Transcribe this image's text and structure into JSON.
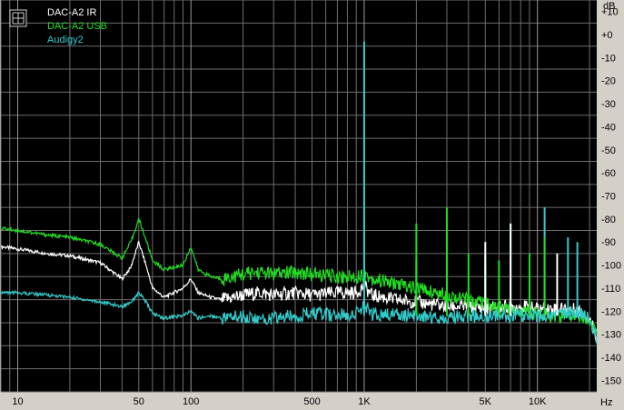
{
  "chart_data": {
    "type": "line",
    "x_scale": "log",
    "xlim": [
      8,
      22000
    ],
    "ylim": [
      -155,
      15
    ],
    "grid": true,
    "background": "#000000",
    "legend_placement": "top-left",
    "xlabel": "Hz",
    "ylabel": "dB",
    "x_ticks": [
      {
        "value": 10,
        "label": "10"
      },
      {
        "value": 50,
        "label": "50"
      },
      {
        "value": 100,
        "label": "100"
      },
      {
        "value": 500,
        "label": "500"
      },
      {
        "value": 1000,
        "label": "1K"
      },
      {
        "value": 5000,
        "label": "5K"
      },
      {
        "value": 10000,
        "label": "10K"
      }
    ],
    "y_ticks": [
      {
        "value": 10,
        "label": "+10"
      },
      {
        "value": 0,
        "label": "+0"
      },
      {
        "value": -10,
        "label": "-10"
      },
      {
        "value": -20,
        "label": "-20"
      },
      {
        "value": -30,
        "label": "-30"
      },
      {
        "value": -40,
        "label": "-40"
      },
      {
        "value": -50,
        "label": "-50"
      },
      {
        "value": -60,
        "label": "-60"
      },
      {
        "value": -70,
        "label": "-70"
      },
      {
        "value": -80,
        "label": "-80"
      },
      {
        "value": -90,
        "label": "-90"
      },
      {
        "value": -100,
        "label": "-100"
      },
      {
        "value": -110,
        "label": "-110"
      },
      {
        "value": -120,
        "label": "-120"
      },
      {
        "value": -130,
        "label": "-130"
      },
      {
        "value": -140,
        "label": "-140"
      },
      {
        "value": -150,
        "label": "-150"
      }
    ],
    "series": [
      {
        "name": "DAC-A2 IR",
        "color": "#ffffff",
        "x": [
          8,
          10,
          15,
          20,
          30,
          40,
          45,
          50,
          55,
          60,
          70,
          90,
          100,
          110,
          130,
          150,
          200,
          250,
          300,
          400,
          500,
          700,
          900,
          1000,
          1100,
          1300,
          1500,
          2000,
          3000,
          4000,
          5000,
          6000,
          8000,
          10000,
          12000,
          15000,
          18000,
          20000,
          22000
        ],
        "y": [
          -92,
          -93,
          -95,
          -96,
          -99,
          -106,
          -101,
          -90,
          -100,
          -110,
          -114,
          -110,
          -106,
          -112,
          -114,
          -115,
          -113,
          -112,
          -113,
          -112,
          -113,
          -112,
          -112,
          -109,
          -113,
          -114,
          -115,
          -116,
          -118,
          -118,
          -119,
          -118,
          -118,
          -119,
          -119,
          -119,
          -120,
          -123,
          -131
        ]
      },
      {
        "name": "DAC-A2 USB",
        "color": "#22dd22",
        "x": [
          8,
          10,
          15,
          20,
          30,
          40,
          45,
          50,
          55,
          60,
          70,
          90,
          100,
          110,
          130,
          150,
          200,
          250,
          300,
          400,
          500,
          700,
          900,
          1000,
          1100,
          1300,
          1500,
          2000,
          3000,
          4000,
          5000,
          6000,
          8000,
          10000,
          12000,
          15000,
          18000,
          20000,
          22000
        ],
        "y": [
          -84,
          -85,
          -87,
          -88,
          -91,
          -97,
          -90,
          -80,
          -89,
          -98,
          -102,
          -100,
          -92,
          -102,
          -105,
          -106,
          -104,
          -103,
          -104,
          -103,
          -104,
          -105,
          -105,
          -104,
          -106,
          -107,
          -108,
          -110,
          -113,
          -115,
          -117,
          -119,
          -120,
          -121,
          -122,
          -122,
          -122,
          -124,
          -130
        ]
      },
      {
        "name": "Audigy2",
        "color": "#33cccc",
        "x": [
          8,
          10,
          15,
          20,
          30,
          40,
          45,
          50,
          55,
          60,
          70,
          90,
          100,
          110,
          130,
          150,
          200,
          250,
          300,
          400,
          500,
          700,
          900,
          1000,
          1100,
          1300,
          1500,
          2000,
          3000,
          4000,
          5000,
          6000,
          8000,
          10000,
          12000,
          15000,
          18000,
          20000,
          22000
        ],
        "y": [
          -112,
          -112,
          -113,
          -114,
          -116,
          -118,
          -116,
          -112,
          -116,
          -121,
          -123,
          -122,
          -120,
          -123,
          -122,
          -123,
          -122,
          -124,
          -123,
          -122,
          -121,
          -122,
          -121,
          -118,
          -121,
          -122,
          -121,
          -122,
          -123,
          -122,
          -122,
          -122,
          -122,
          -122,
          -122,
          -121,
          -121,
          -123,
          -133
        ]
      }
    ],
    "spikes": [
      {
        "series": "Audigy2",
        "x": 1000,
        "y": -3
      },
      {
        "series": "Audigy2",
        "x": 2000,
        "y": -98
      },
      {
        "series": "Audigy2",
        "x": 3000,
        "y": -82
      },
      {
        "series": "Audigy2",
        "x": 5000,
        "y": -100
      },
      {
        "series": "Audigy2",
        "x": 7000,
        "y": -82
      },
      {
        "series": "Audigy2",
        "x": 9000,
        "y": -107
      },
      {
        "series": "Audigy2",
        "x": 11000,
        "y": -75
      },
      {
        "series": "Audigy2",
        "x": 15000,
        "y": -88
      },
      {
        "series": "Audigy2",
        "x": 17000,
        "y": -90
      },
      {
        "series": "DAC-A2 USB",
        "x": 2000,
        "y": -82
      },
      {
        "series": "DAC-A2 USB",
        "x": 3000,
        "y": -75
      },
      {
        "series": "DAC-A2 USB",
        "x": 4000,
        "y": -95
      },
      {
        "series": "DAC-A2 USB",
        "x": 5000,
        "y": -95
      },
      {
        "series": "DAC-A2 USB",
        "x": 6000,
        "y": -98
      },
      {
        "series": "DAC-A2 USB",
        "x": 9000,
        "y": -95
      },
      {
        "series": "DAC-A2 USB",
        "x": 11000,
        "y": -88
      },
      {
        "series": "DAC-A2 IR",
        "x": 5000,
        "y": -90
      },
      {
        "series": "DAC-A2 IR",
        "x": 7000,
        "y": -82
      },
      {
        "series": "DAC-A2 IR",
        "x": 13000,
        "y": -95
      }
    ]
  }
}
